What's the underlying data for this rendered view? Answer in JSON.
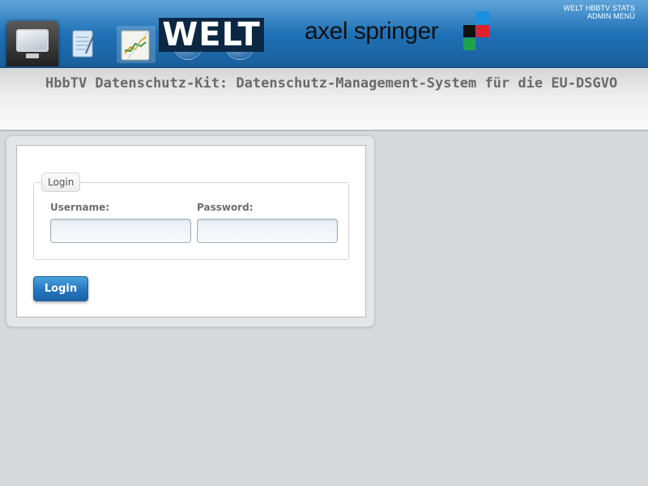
{
  "header": {
    "welt_logo_text": "WELT",
    "springer_logo_text": "axel springer",
    "nav_icons": [
      "monitor-icon",
      "notes-icon",
      "chart-icon"
    ],
    "admin_links": [
      "WELT HBBTV STATS",
      "ADMIN MENÜ"
    ]
  },
  "page": {
    "title": "HbbTV Datenschutz-Kit: Datenschutz-Management-System für die EU-DSGVO"
  },
  "login": {
    "legend": "Login",
    "username_label": "Username:",
    "password_label": "Password:",
    "username_value": "",
    "password_value": "",
    "submit_label": "Login"
  },
  "colors": {
    "banner_blue": "#1f6fb4",
    "button_blue": "#2576c0",
    "springer_blue": "#1a8fe0",
    "springer_red": "#e0202a",
    "springer_black": "#111111",
    "springer_green": "#1ea24a"
  }
}
